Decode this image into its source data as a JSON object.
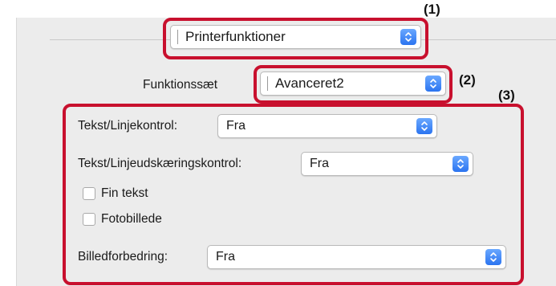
{
  "markers": [
    "(1)",
    "(2)",
    "(3)"
  ],
  "panel_popup": {
    "value": "Printerfunktioner",
    "icon": "chevron-updown-icon"
  },
  "feature_set": {
    "label": "Funktionssæt",
    "value": "Avanceret2"
  },
  "options": {
    "text_line_control": {
      "label": "Tekst/Linjekontrol:",
      "value": "Fra"
    },
    "text_line_cut_control": {
      "label": "Tekst/Linjeudskæringskontrol:",
      "value": "Fra"
    },
    "fine_text": {
      "label": "Fin tekst",
      "checked": false
    },
    "photo": {
      "label": "Fotobillede",
      "checked": false
    },
    "image_enhancement": {
      "label": "Billedforbedring:",
      "value": "Fra"
    }
  },
  "colors": {
    "highlight": "#c8102e",
    "stepper": "#2b74f0",
    "panel_bg": "#ececec"
  }
}
